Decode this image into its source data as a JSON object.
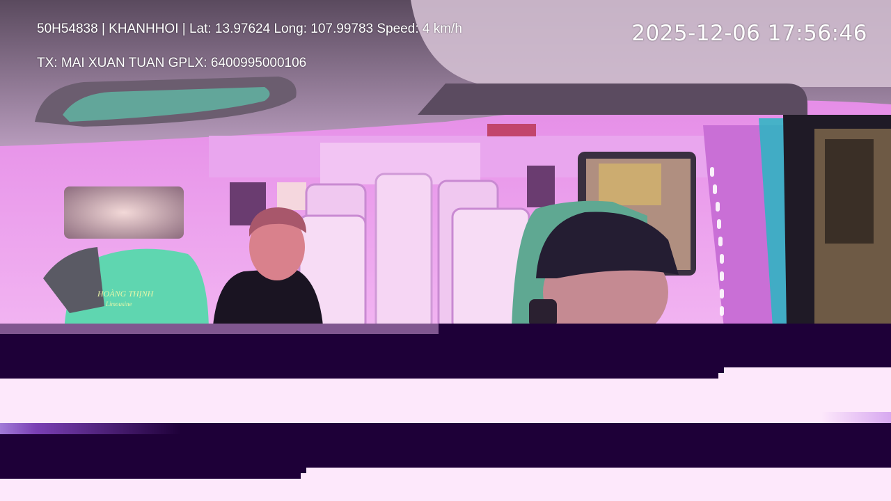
{
  "overlay": {
    "info_line": "50H54838 | KHANHHOI | Lat: 13.97624 Long: 107.99783 Speed: 4 km/h",
    "driver_line": "TX: MAI XUAN TUAN GPLX: 6400995000106",
    "timestamp": "2025-12-06 17:56:46"
  },
  "seat_logo": {
    "brand": "HOÀNG THỊNH",
    "sub": "Limousine"
  },
  "colors": {
    "cabin_light": "#e58fe8",
    "ceiling": "#b89bb8",
    "seat_green": "#5fd6b0",
    "glitch_dark": "#1e0038",
    "glitch_light": "#fde8fb",
    "text": "#ffffff"
  }
}
